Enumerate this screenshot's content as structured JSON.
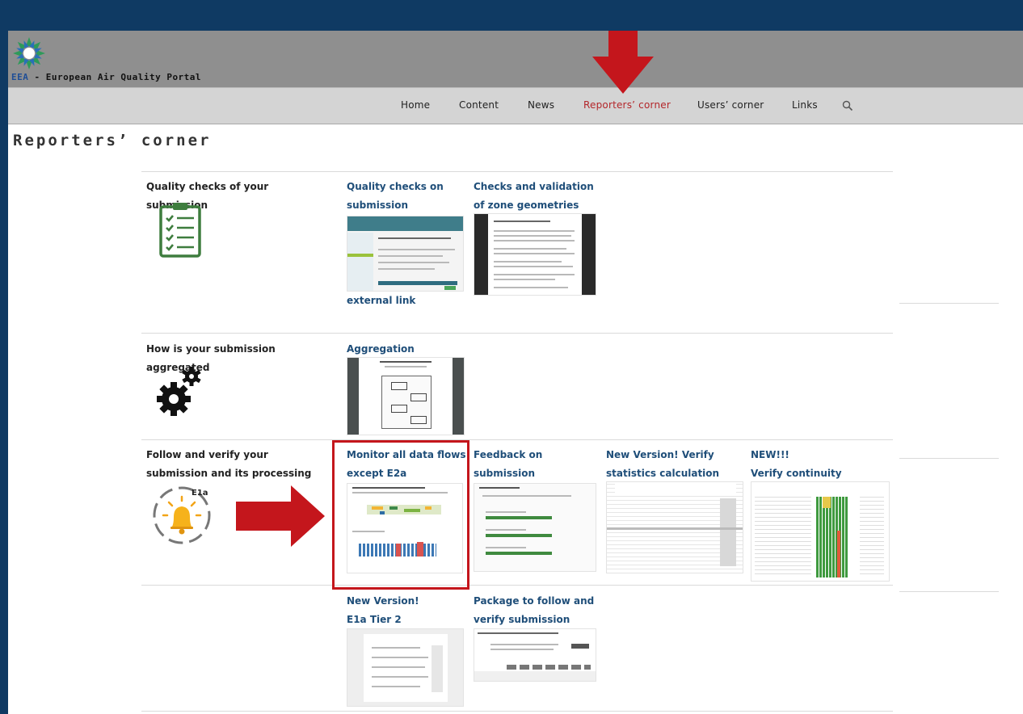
{
  "header": {
    "site_abbr": "EEA",
    "site_rest": " - European Air Quality Portal",
    "logo_icon": "eea-logo-icon"
  },
  "nav": {
    "items": [
      "Home",
      "Content",
      "News",
      "Reporters’ corner",
      "Users’ corner",
      "Links"
    ],
    "active": "Reporters’ corner",
    "search_icon": "search-icon"
  },
  "page": {
    "title": "Reporters’ corner"
  },
  "rows": [
    {
      "label": "Quality checks of your submission",
      "icon": "clipboard-checklist-icon",
      "cards": [
        {
          "title_lines": [
            "Quality checks on",
            "submission"
          ],
          "footer": "external link"
        },
        {
          "title_lines": [
            "Checks and validation",
            "of zone geometries"
          ]
        }
      ]
    },
    {
      "label": "How is your submission aggregated",
      "icon": "gears-icon",
      "cards": [
        {
          "title_lines": [
            "Aggregation"
          ]
        }
      ]
    },
    {
      "label": "Follow and verify your submission and its processing",
      "icon": "bell-cycle-icon",
      "icon_text": "E1a",
      "cards": [
        {
          "title_lines": [
            "Monitor all data flows",
            "except E2a"
          ]
        },
        {
          "title_lines": [
            "Feedback on",
            "submission"
          ]
        },
        {
          "title_lines": [
            "New Version! Verify",
            "statistics calculation"
          ]
        },
        {
          "title_lines": [
            "NEW!!!",
            "Verify continuity"
          ]
        }
      ]
    },
    {
      "label": "",
      "cards": [
        {
          "title_lines": [
            "New Version!",
            "E1a Tier 2"
          ]
        },
        {
          "title_lines": [
            "Package to follow and",
            "verify submission"
          ]
        }
      ]
    }
  ],
  "colors": {
    "outer_background": "#0f3a63",
    "banner": "#8f8f8f",
    "navbar": "#d4d4d4",
    "link": "#1f4e79",
    "active_nav": "#b3262a",
    "annotation_red": "#c4161c"
  }
}
